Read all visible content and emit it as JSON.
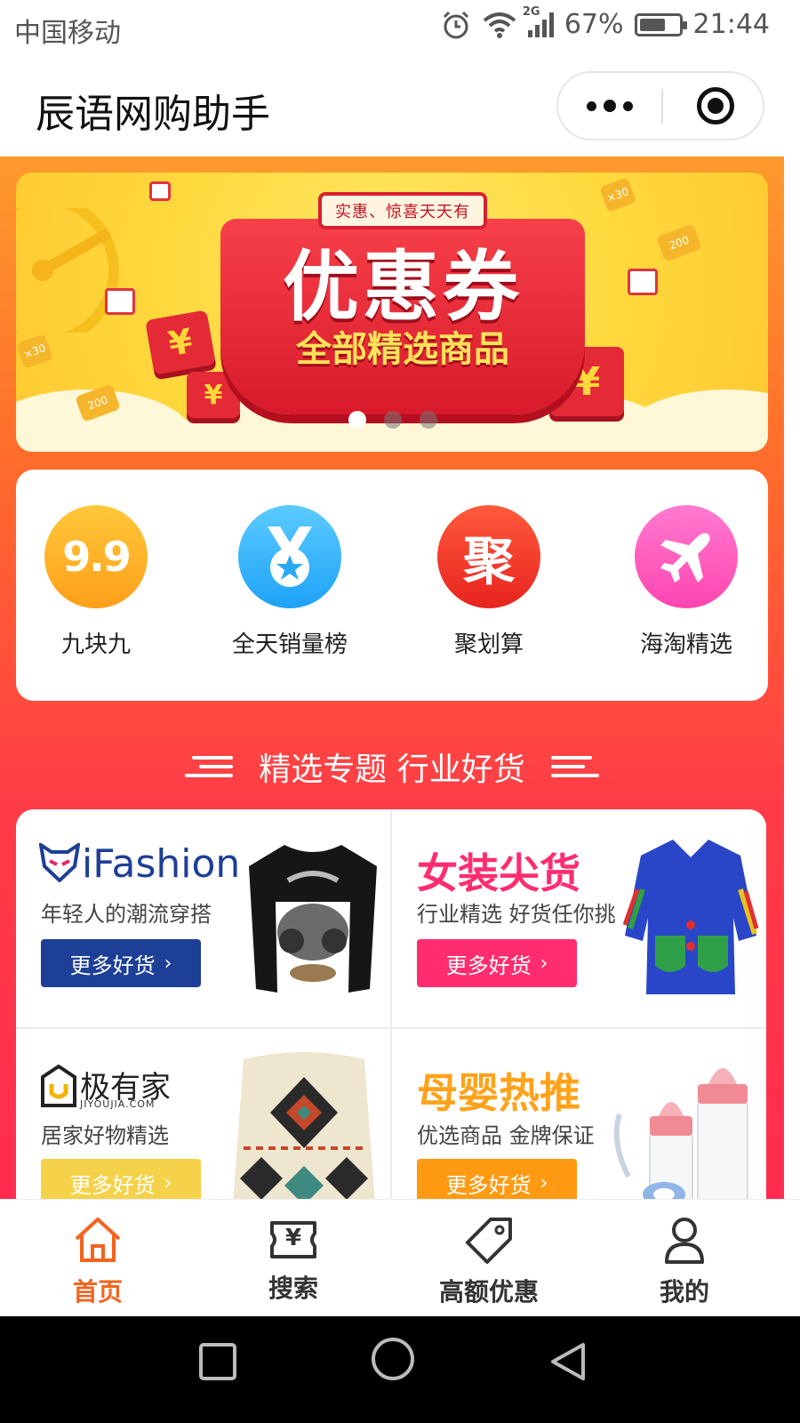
{
  "status_bar": {
    "carrier": "中国移动",
    "network": "2G",
    "battery_percent": "67%",
    "battery_level": 0.67,
    "time": "21:44"
  },
  "title_bar": {
    "title": "辰语网购助手"
  },
  "banner": {
    "tag": "实惠、惊喜天天有",
    "headline": "优惠券",
    "subline": "全部精选商品",
    "slide_count": 3,
    "active_slide": 0,
    "coin_labels": [
      "200",
      "200",
      "×30",
      "×30",
      "200"
    ],
    "yen_symbol": "¥"
  },
  "categories": [
    {
      "label": "九块九",
      "icon_text": "9.9",
      "color_top": "#ffc83a",
      "color_bottom": "#ff9f1a"
    },
    {
      "label": "全天销量榜",
      "icon_text": "",
      "color_top": "#5bcbff",
      "color_bottom": "#1ea2f6"
    },
    {
      "label": "聚划算",
      "icon_text": "聚",
      "color_top": "#ff5a3c",
      "color_bottom": "#e8231f"
    },
    {
      "label": "海淘精选",
      "icon_text": "",
      "color_top": "#ff7ad0",
      "color_bottom": "#ff45b0"
    }
  ],
  "section": {
    "title": "精选专题 行业好货"
  },
  "topics": [
    {
      "name": "iFashion",
      "desc": "年轻人的潮流穿搭",
      "button": "更多好货",
      "name_color": "#1d3f96",
      "button_color": "#1d3f96"
    },
    {
      "name": "女装尖货",
      "desc": "行业精选 好货任你挑",
      "button": "更多好货",
      "name_color": "#ff2d6f",
      "button_color": "#ff2d6f"
    },
    {
      "name": "极有家",
      "brand_sub": "JIYOUJIA.COM",
      "desc": "居家好物精选",
      "button": "更多好货",
      "name_color": "#222222",
      "button_color": "#f6d24a"
    },
    {
      "name": "母婴热推",
      "desc": "优选商品 金牌保证",
      "button": "更多好货",
      "name_color": "#ffa21a",
      "button_color": "#ff9a12"
    }
  ],
  "tabbar": [
    {
      "label": "首页",
      "active": true
    },
    {
      "label": "搜索",
      "active": false,
      "icon_text": "¥"
    },
    {
      "label": "高额优惠",
      "active": false
    },
    {
      "label": "我的",
      "active": false
    }
  ],
  "colors": {
    "accent": "#f2641f",
    "gradient_top": "#ff9a2d",
    "gradient_bottom": "#ff2c4f"
  }
}
